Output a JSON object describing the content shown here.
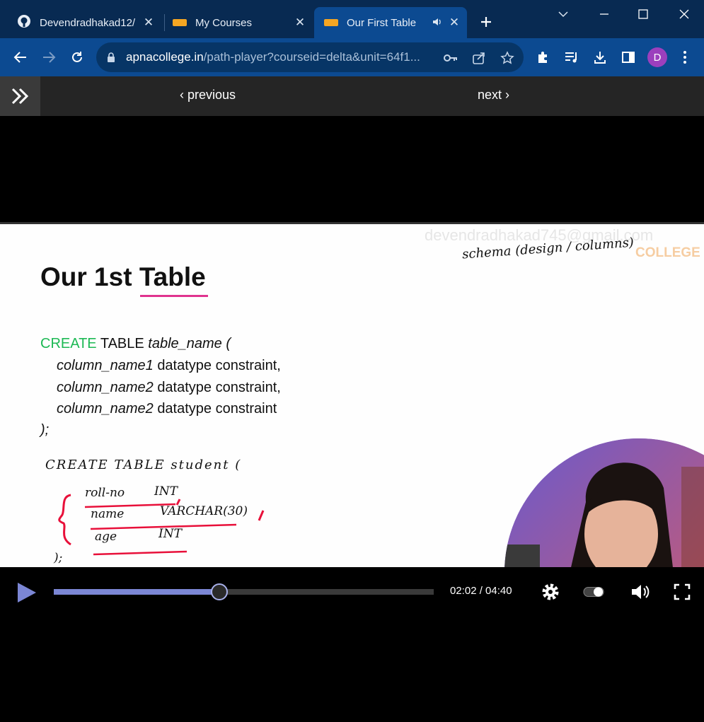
{
  "tabs": [
    {
      "label": "Devendradhakad12/",
      "active": false
    },
    {
      "label": "My Courses",
      "active": false
    },
    {
      "label": "Our First Table",
      "active": true
    }
  ],
  "address_bar": {
    "host": "apnacollege.in",
    "path": "/path-player?courseid=delta&unit=64f1..."
  },
  "profile_initial": "D",
  "site_nav": {
    "previous_label": "previous",
    "next_label": "next"
  },
  "slide": {
    "title": "Our 1st Table",
    "watermark": "devendradhakad745@gmail.com",
    "watermark_brand": "COLLEGE",
    "code": {
      "line1_kw1": "CREATE",
      "line1_kw2": "TABLE",
      "line1_rest": "table_name (",
      "line2_col": "column_name1",
      "line2_rest": "datatype constraint,",
      "line3_col": "column_name2",
      "line3_rest": "datatype constraint,",
      "line4_col": "column_name2",
      "line4_rest": "datatype constraint",
      "line5": ");"
    },
    "annotations": {
      "schema_note": "schema (design / columns)",
      "create_stmt": "CREATE  TABLE  student (",
      "col1_name": "roll-no",
      "col1_type": "INT",
      "col2_name": "name",
      "col2_type": "VARCHAR(30)",
      "col3_name": "age",
      "col3_type": "INT",
      "closing": ");"
    }
  },
  "player": {
    "current_time": "02:02",
    "duration": "04:40",
    "time_display": "02:02 / 04:40",
    "progress_fraction": 0.436
  },
  "colors": {
    "tab_bar": "#082a52",
    "toolbar": "#0c4a91",
    "keyword_green": "#1db954",
    "underline_pink": "#e0338f",
    "progress": "#7b86d4",
    "avatar": "#9c3fbd"
  }
}
